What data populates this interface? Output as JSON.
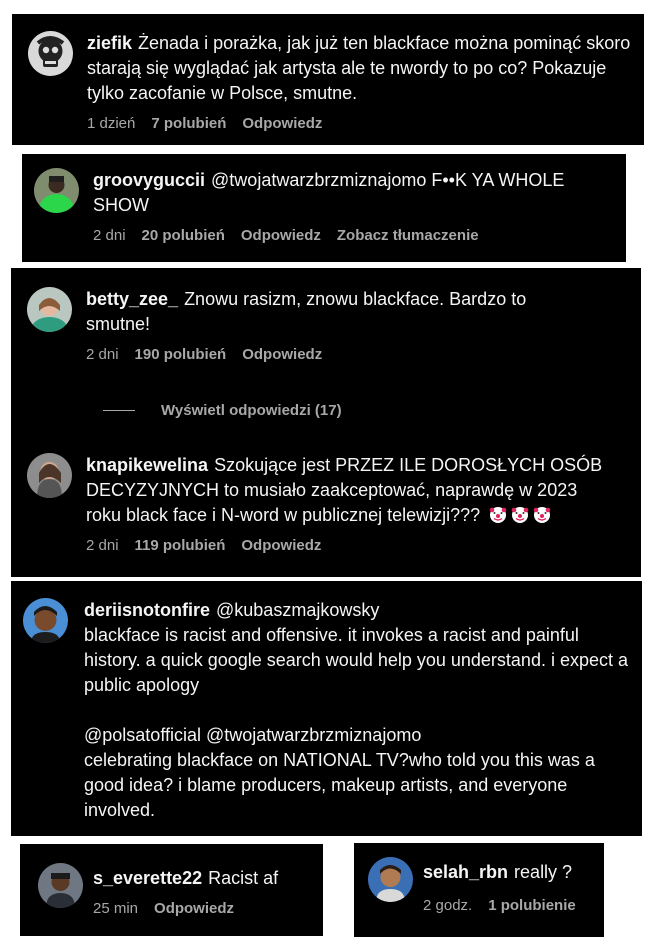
{
  "comments": [
    {
      "username": "ziefik",
      "text": "Żenada i porażka, jak już ten blackface można pominąć skoro starają się wyglądać jak artysta ale te nwordy to po co? Pokazuje tylko zacofanie w Polsce, smutne.",
      "time": "1 dzień",
      "likes": "7 polubień",
      "reply": "Odpowiedz"
    },
    {
      "username": "groovyguccii",
      "text": "@twojatwarzbrzmiznajomo F••K YA WHOLE SHOW",
      "time": "2 dni",
      "likes": "20 polubień",
      "reply": "Odpowiedz",
      "translate": "Zobacz tłumaczenie"
    },
    {
      "username": "betty_zee_",
      "text": "Znowu rasizm, znowu blackface. Bardzo to smutne!",
      "time": "2 dni",
      "likes": "190 polubień",
      "reply": "Odpowiedz",
      "view_replies": "Wyświetl odpowiedzi (17)"
    },
    {
      "username": "knapikewelina",
      "text": "Szokujące jest PRZEZ ILE DOROSŁYCH OSÓB DECYZYJNYCH to musiało zaakceptować, naprawdę w 2023 roku black face i N-word w publicznej telewizji???",
      "time": "2 dni",
      "likes": "119 polubień",
      "reply": "Odpowiedz"
    },
    {
      "username": "deriisnotonfire",
      "text_line1": "@kubaszmajkowsky",
      "text_para1": "blackface is racist and offensive. it invokes a racist and painful history. a quick google search would help you understand. i expect a public apology",
      "text_line2": "@polsatofficial @twojatwarzbrzmiznajomo",
      "text_para2": "celebrating blackface on NATIONAL TV?who told you this was a good idea? i blame producers, makeup artists, and everyone involved."
    },
    {
      "username": "s_everette22",
      "text": "Racist af",
      "time": "25 min",
      "reply": "Odpowiedz"
    },
    {
      "username": "selah_rbn",
      "text": "really ?",
      "time": "2 godz.",
      "likes": "1 polubienie"
    }
  ],
  "colors": {
    "card_bg": "#000000",
    "text": "#f5f5f5",
    "meta": "#a8a8a8",
    "page_bg": "#ffffff"
  },
  "icons": [
    "clown-face-emoji"
  ]
}
